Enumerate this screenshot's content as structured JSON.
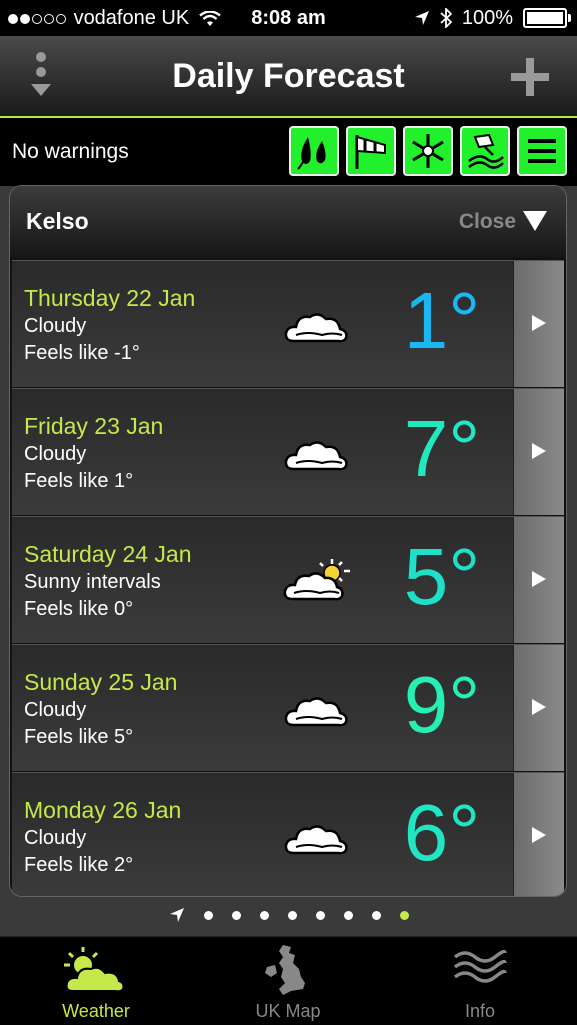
{
  "status_bar": {
    "carrier": "vodafone UK",
    "time": "8:08 am",
    "battery": "100%"
  },
  "nav": {
    "title": "Daily Forecast"
  },
  "warnings": {
    "text": "No warnings",
    "buttons": [
      "rain-icon",
      "wind-icon",
      "snow-icon",
      "ice-icon",
      "menu-icon"
    ]
  },
  "panel": {
    "location": "Kelso",
    "close_label": "Close"
  },
  "days": [
    {
      "day": "Thursday 22 Jan",
      "condition": "Cloudy",
      "feels": "Feels like -1°",
      "temp": "1°",
      "color": "#1ab8f2",
      "icon": "cloud-icon"
    },
    {
      "day": "Friday 23 Jan",
      "condition": "Cloudy",
      "feels": "Feels like 1°",
      "temp": "7°",
      "color": "#22e8c0",
      "icon": "cloud-icon"
    },
    {
      "day": "Saturday 24 Jan",
      "condition": "Sunny intervals",
      "feels": "Feels like 0°",
      "temp": "5°",
      "color": "#1ee0c8",
      "icon": "sunny-intervals-icon"
    },
    {
      "day": "Sunday 25 Jan",
      "condition": "Cloudy",
      "feels": "Feels like 5°",
      "temp": "9°",
      "color": "#25f0b4",
      "icon": "cloud-icon"
    },
    {
      "day": "Monday 26 Jan",
      "condition": "Cloudy",
      "feels": "Feels like 2°",
      "temp": "6°",
      "color": "#20e6c4",
      "icon": "cloud-icon"
    }
  ],
  "pager": {
    "count": 8,
    "active_index": 7
  },
  "tabs": [
    {
      "label": "Weather",
      "active": true
    },
    {
      "label": "UK Map",
      "active": false
    },
    {
      "label": "Info",
      "active": false
    }
  ],
  "colors": {
    "accent": "#c5e84a",
    "warning_green": "#22f02c"
  }
}
